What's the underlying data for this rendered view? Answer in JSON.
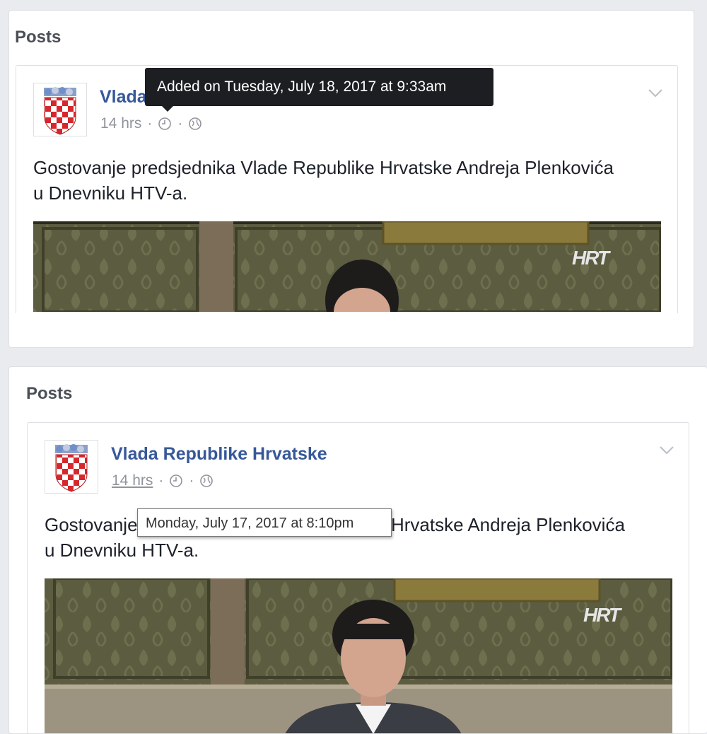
{
  "panels": [
    {
      "heading": "Posts",
      "post": {
        "page_name": "Vlada",
        "time_ago": "14 hrs",
        "separator": "·",
        "text": "Gostovanje predsjednika Vlade Republike Hrvatske Andreja Plenkovića\nu Dnevniku HTV-a.",
        "video_logo": "HRT"
      },
      "tooltip": "Added on Tuesday, July 18, 2017 at 9:33am"
    },
    {
      "heading": "Posts",
      "post": {
        "page_name": "Vlada Republike Hrvatske",
        "time_ago": "14 hrs",
        "separator": "·",
        "text": "Gostovanje predsjednika Vlade Republike Hrvatske Andreja Plenkovića\nu Dnevniku HTV-a.",
        "video_logo": "HRT"
      },
      "tooltip": "Monday, July 17, 2017 at 8:10pm"
    }
  ],
  "icons": [
    "croatia-coat-of-arms-icon",
    "clock-icon",
    "globe-icon",
    "chevron-down-icon"
  ],
  "colors": {
    "page_bg": "#e9ebee",
    "link_blue": "#365899",
    "meta_gray": "#90949c",
    "tooltip_dark": "#1c1e21"
  }
}
